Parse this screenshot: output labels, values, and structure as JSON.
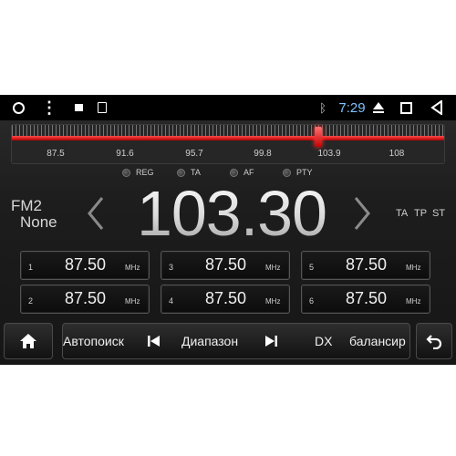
{
  "status_bar": {
    "time": "7:29",
    "icons": [
      "circle-home-icon",
      "more-dots-icon",
      "image-icon",
      "sd-card-icon",
      "bluetooth-icon",
      "eject-icon",
      "square-recents-icon",
      "back-triangle-icon"
    ],
    "time_color": "#7fc3ff"
  },
  "scale": {
    "labels": [
      "87.5",
      "91.6",
      "95.7",
      "99.8",
      "103.9",
      "108"
    ],
    "range": [
      87.5,
      108.0
    ],
    "needle_value": 103.3,
    "accent": "#e00000"
  },
  "flags": [
    "REG",
    "TA",
    "AF",
    "PTY"
  ],
  "tuner": {
    "band": "FM2",
    "ps_name": "None",
    "frequency": "103.30",
    "indicators": [
      "TA",
      "TP",
      "ST"
    ]
  },
  "presets": [
    {
      "num": "1",
      "freq": "87.50",
      "unit": "MHz"
    },
    {
      "num": "3",
      "freq": "87.50",
      "unit": "MHz"
    },
    {
      "num": "5",
      "freq": "87.50",
      "unit": "MHz"
    },
    {
      "num": "2",
      "freq": "87.50",
      "unit": "MHz"
    },
    {
      "num": "4",
      "freq": "87.50",
      "unit": "MHz"
    },
    {
      "num": "6",
      "freq": "87.50",
      "unit": "MHz"
    }
  ],
  "controls": {
    "autosearch": "Автопоиск",
    "range": "Диапазон",
    "dx": "DX",
    "balance": "балансир",
    "icons": [
      "home-icon",
      "skip-previous-icon",
      "skip-next-icon",
      "return-icon"
    ]
  }
}
